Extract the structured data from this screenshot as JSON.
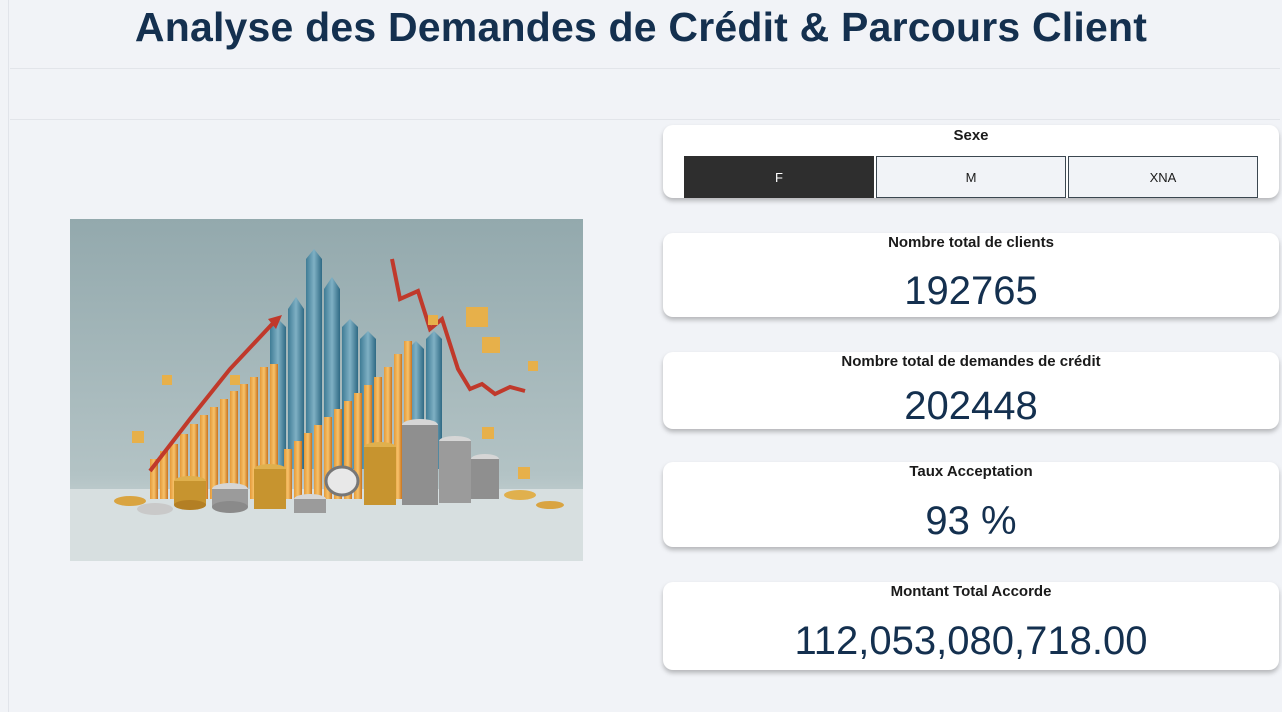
{
  "page": {
    "title": "Analyse des Demandes de Crédit & Parcours Client"
  },
  "hero_image": {
    "description_icon": "finance-growth-illustration"
  },
  "slicer": {
    "label": "Sexe",
    "options": [
      "F",
      "M",
      "XNA"
    ],
    "selected": "F"
  },
  "kpis": {
    "clients": {
      "label": "Nombre total de clients",
      "value": "192765"
    },
    "demandes": {
      "label": "Nombre total de demandes de crédit",
      "value": "202448"
    },
    "acceptation": {
      "label": "Taux Acceptation",
      "value": "93 %"
    },
    "montant": {
      "label": "Montant Total Accorde",
      "value": "112,053,080,718.00"
    }
  },
  "colors": {
    "title": "#14304f",
    "background": "#f1f3f7",
    "slicer_active": "#2e2e2e"
  }
}
